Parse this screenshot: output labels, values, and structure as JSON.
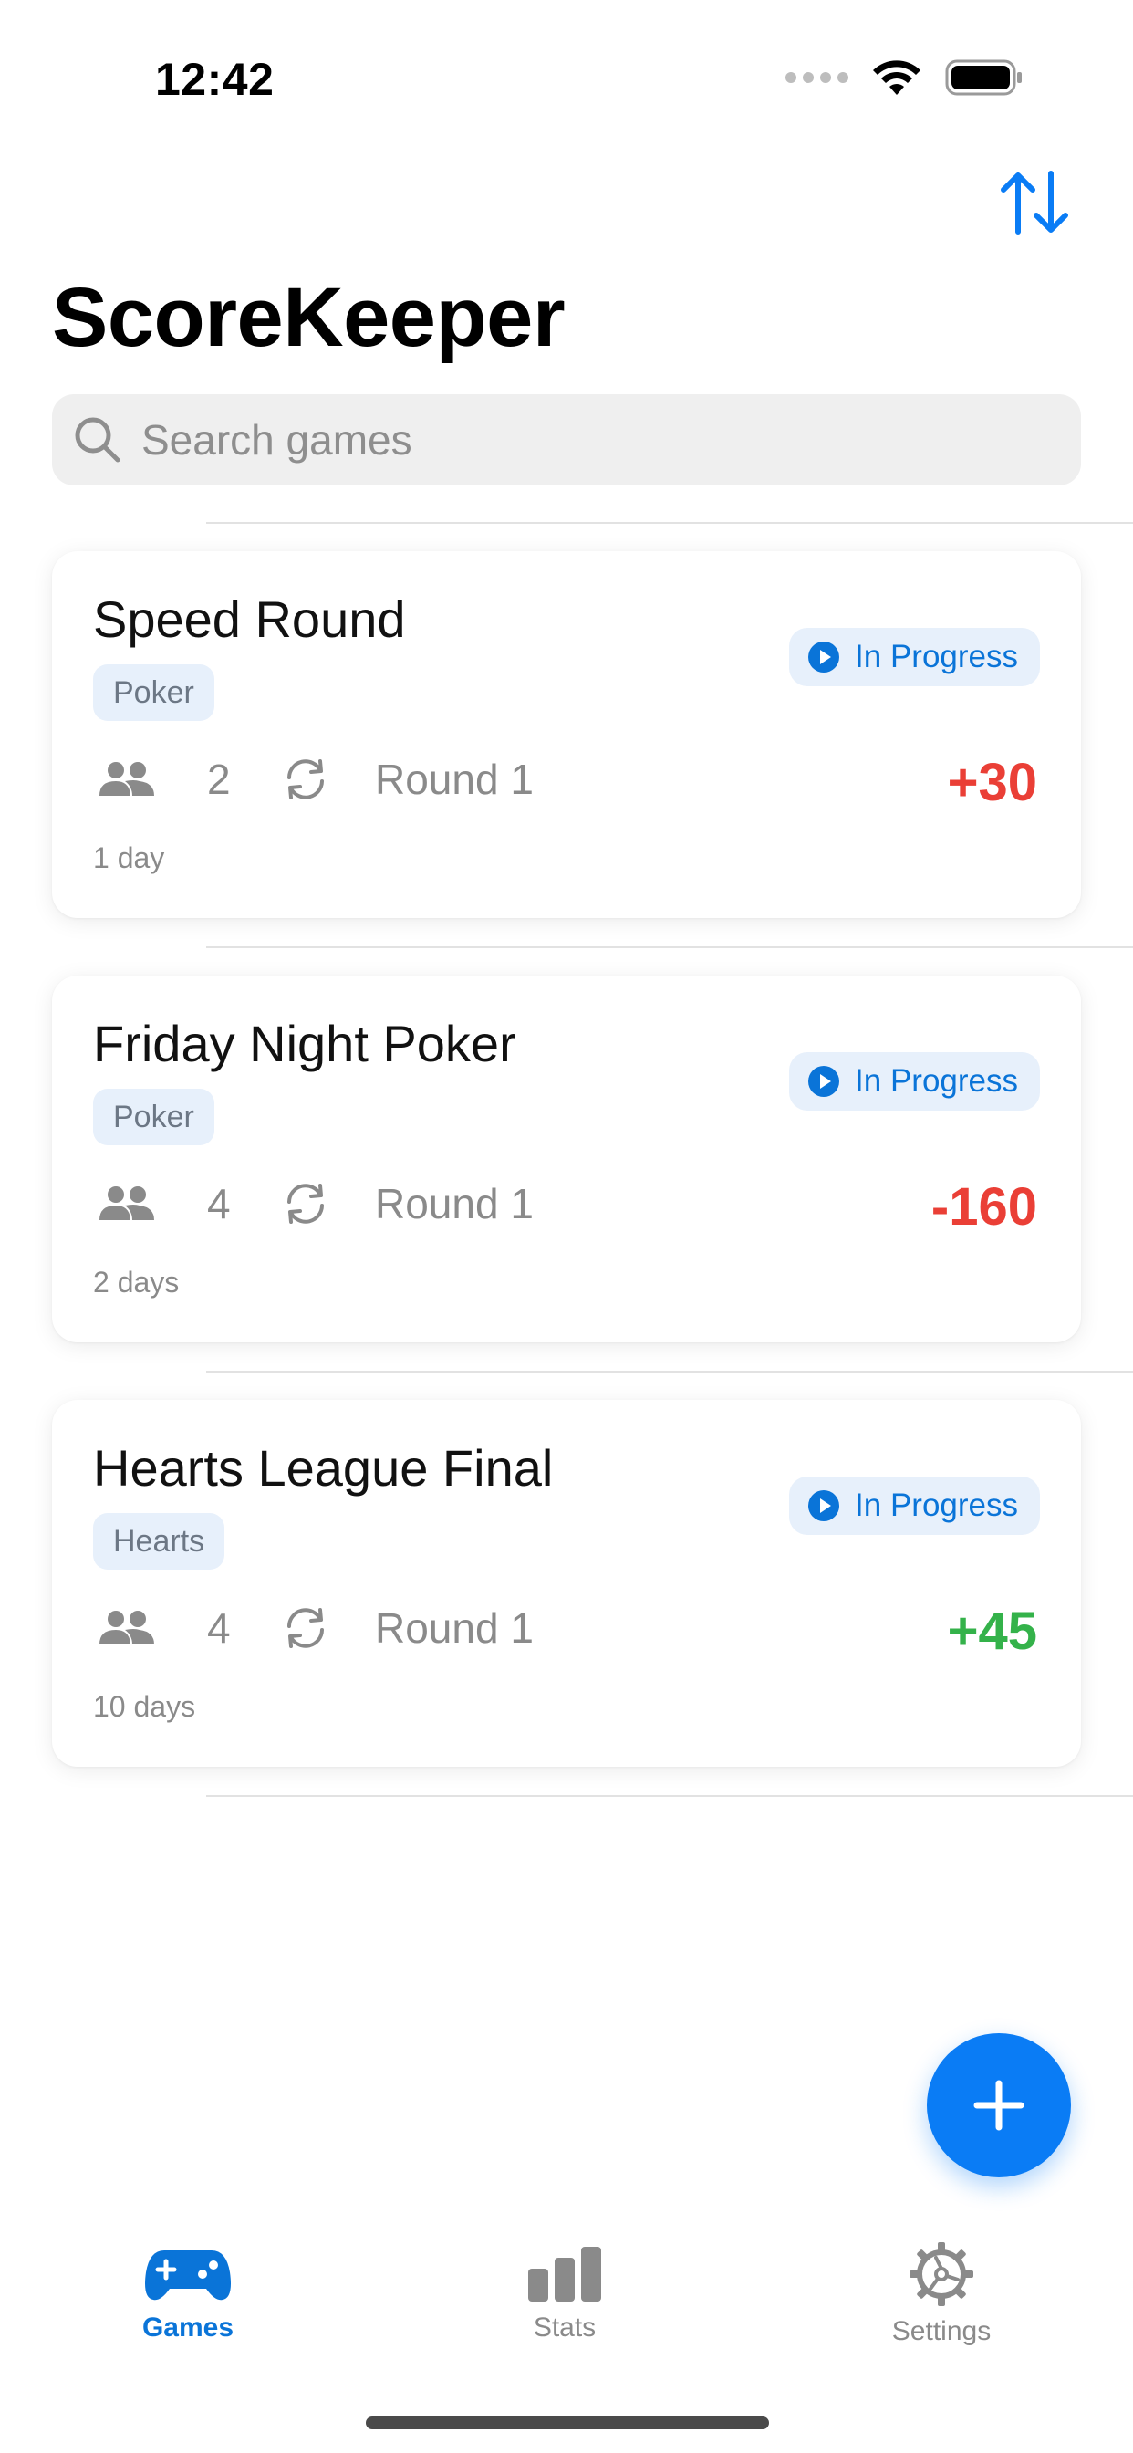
{
  "status_bar": {
    "time": "12:42"
  },
  "app": {
    "title": "ScoreKeeper"
  },
  "search": {
    "placeholder": "Search games"
  },
  "games": [
    {
      "title": "Speed Round",
      "tag": "Poker",
      "status": "In Progress",
      "players": "2",
      "round": "Round 1",
      "score": "+30",
      "time": "1 day"
    },
    {
      "title": "Friday Night Poker",
      "tag": "Poker",
      "status": "In Progress",
      "players": "4",
      "round": "Round 1",
      "score": "-160",
      "time": "2 days"
    },
    {
      "title": "Hearts League Final",
      "tag": "Hearts",
      "status": "In Progress",
      "players": "4",
      "round": "Round 1",
      "score": "+45",
      "time": "10 days"
    }
  ],
  "tabs": [
    {
      "label": "Games",
      "icon": "gamecontroller-icon",
      "active": true
    },
    {
      "label": "Stats",
      "icon": "bar-chart-icon",
      "active": false
    },
    {
      "label": "Settings",
      "icon": "gear-icon",
      "active": false
    }
  ],
  "colors": {
    "accent": "#0a7cf5",
    "negative": "#ea3f36",
    "positive": "#34b24a",
    "muted": "#8a8a8a"
  }
}
